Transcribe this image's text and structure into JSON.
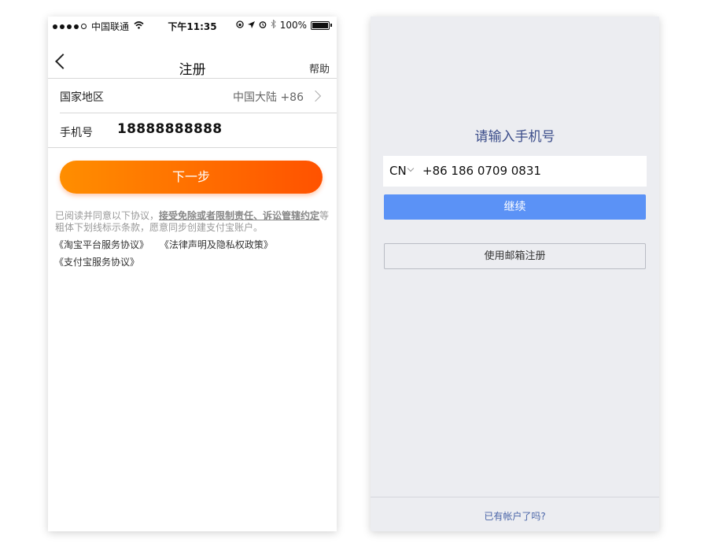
{
  "left": {
    "status": {
      "carrier": "中国联通",
      "time": "下午11:35",
      "battery": "100%"
    },
    "nav": {
      "title": "注册",
      "help": "帮助"
    },
    "region": {
      "label": "国家地区",
      "value": "中国大陆 +86"
    },
    "phone": {
      "label": "手机号",
      "value": "18888888888"
    },
    "next_label": "下一步",
    "agreement": {
      "prefix": "已阅读并同意以下协议，",
      "bold": "接受免除或者限制责任、诉讼管辖约定",
      "suffix": "等粗体下划线标示条款，愿意同步创建支付宝账户。",
      "link1": "《淘宝平台服务协议》",
      "link2": "《法律声明及隐私权政策》",
      "link3": "《支付宝服务协议》"
    },
    "colors": {
      "accent_start": "#ff8e00",
      "accent_end": "#ff5200"
    }
  },
  "right": {
    "title": "请输入手机号",
    "country_code": "CN",
    "phone_value": "+86  186 0709 0831",
    "continue_label": "继续",
    "email_label": "使用邮箱注册",
    "login_link": "已有帐户了吗?",
    "colors": {
      "primary": "#5b92f6",
      "title": "#3b4d8a"
    }
  }
}
